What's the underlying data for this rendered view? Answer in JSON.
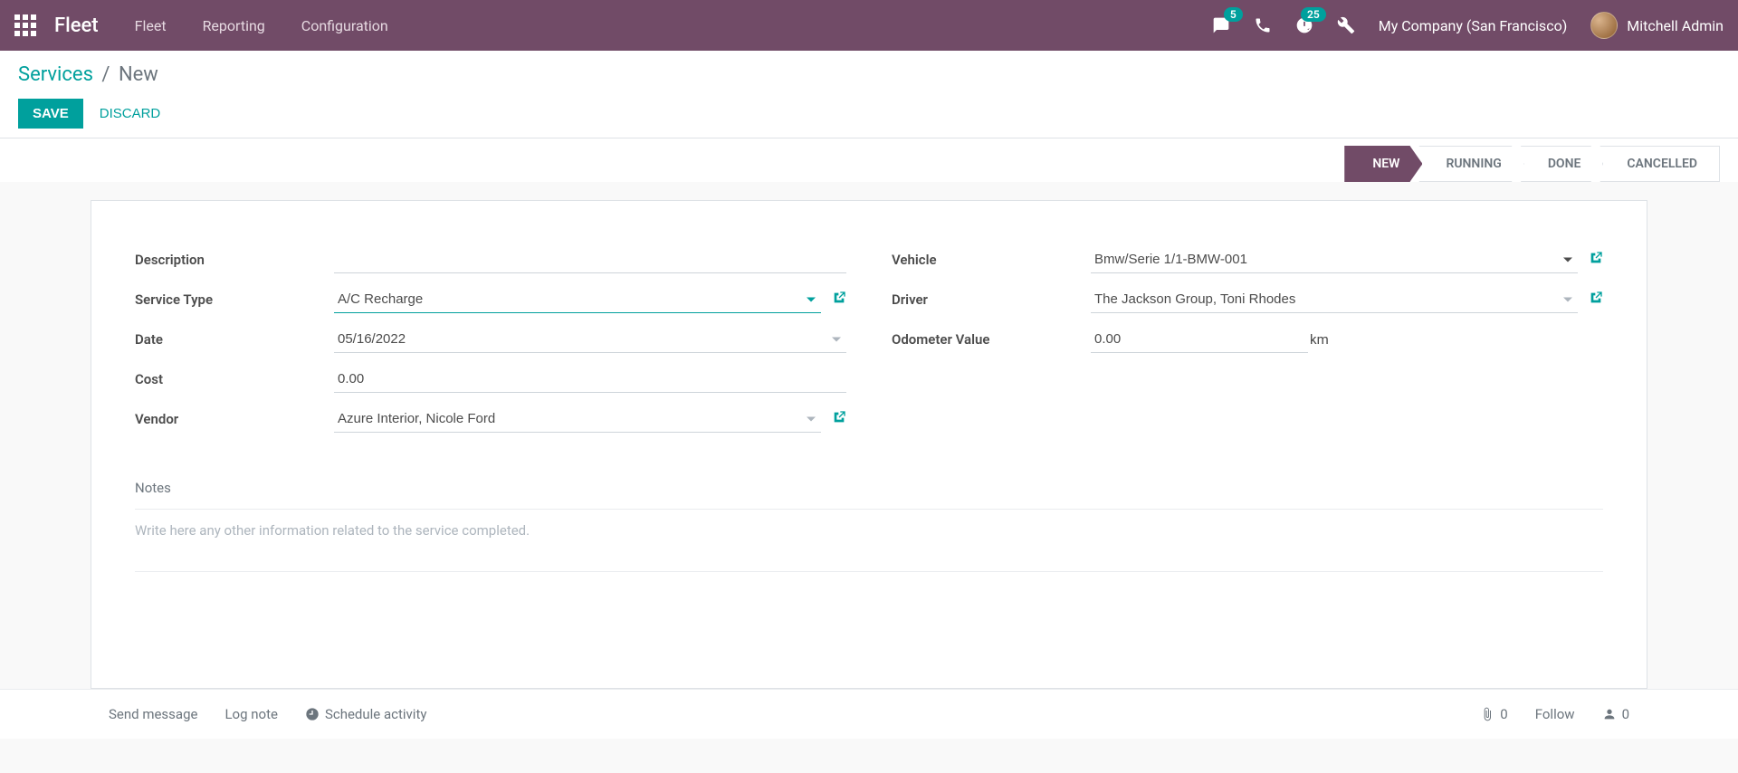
{
  "topnav": {
    "brand": "Fleet",
    "links": [
      "Fleet",
      "Reporting",
      "Configuration"
    ],
    "messages_badge": "5",
    "activities_badge": "25",
    "company": "My Company (San Francisco)",
    "user": "Mitchell Admin"
  },
  "breadcrumb": {
    "root": "Services",
    "current": "New"
  },
  "buttons": {
    "save": "Save",
    "discard": "Discard"
  },
  "status_steps": [
    "New",
    "Running",
    "Done",
    "Cancelled"
  ],
  "active_step": "New",
  "form": {
    "description": {
      "label": "Description",
      "value": ""
    },
    "service_type": {
      "label": "Service Type",
      "value": "A/C Recharge"
    },
    "date": {
      "label": "Date",
      "value": "05/16/2022"
    },
    "cost": {
      "label": "Cost",
      "value": "0.00"
    },
    "vendor": {
      "label": "Vendor",
      "value": "Azure Interior, Nicole Ford"
    },
    "vehicle": {
      "label": "Vehicle",
      "value": "Bmw/Serie 1/1-BMW-001"
    },
    "driver": {
      "label": "Driver",
      "value": "The Jackson Group, Toni Rhodes"
    },
    "odometer": {
      "label": "Odometer Value",
      "value": "0.00",
      "unit": "km"
    }
  },
  "notes": {
    "label": "Notes",
    "placeholder": "Write here any other information related to the service completed.",
    "value": ""
  },
  "chatter": {
    "send": "Send message",
    "log": "Log note",
    "schedule": "Schedule activity",
    "attachments": "0",
    "follow": "Follow",
    "followers": "0"
  }
}
